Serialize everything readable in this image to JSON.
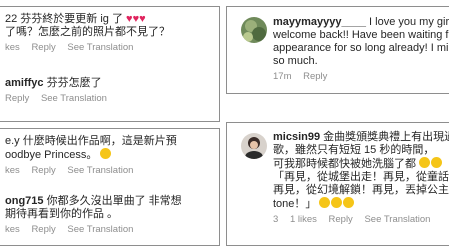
{
  "comments": [
    {
      "text_line1": "22 芬芬終於要更新 ig 了",
      "hearts": "♥♥♥",
      "text_line2": "了嗎？怎麼之前的照片都不見了？",
      "likes": "kes",
      "reply": "Reply",
      "see_translation": "See Translation"
    },
    {
      "user": "amiffyc",
      "text": "芬芬怎麼了",
      "time": "",
      "reply": "Reply",
      "see_translation": "See Translation"
    },
    {
      "text_line1": "e.y 什麼時候出作品啊，這是新片預",
      "text_line2": "oodbye Princess。",
      "likes": "kes",
      "reply": "Reply",
      "see_translation": "See Translation"
    },
    {
      "user": "ong715",
      "text_line1": "你都多久沒出單曲了 非常想",
      "text_line2": "期待再看到你的作品 。",
      "likes": "kes",
      "reply": "Reply",
      "see_translation": "See Translation"
    },
    {
      "user": "mayymayyyy____",
      "text_line1": "I love you my girl",
      "text_line2": "welcome back!! Have been waiting f",
      "text_line3": "appearance for so long already! I mi",
      "text_line4": "so much.",
      "time": "17m",
      "reply": "Reply"
    },
    {
      "user": "micsin99",
      "text_line1": "金曲獎頒獎典禮上有出現過",
      "text_line2": "歌，雖然只有短短 15 秒的時間，",
      "text_line3": "可我那時候都快被她洗腦了都",
      "text_line4": "「再見，從城堡出走！再見，從童話",
      "text_line5": "再見，從幻境解鎖！再見，丟掉公主",
      "text_line6": "tone！」",
      "time": "3",
      "likes": "1 likes",
      "reply": "Reply",
      "see_translation": "See Translation"
    }
  ]
}
